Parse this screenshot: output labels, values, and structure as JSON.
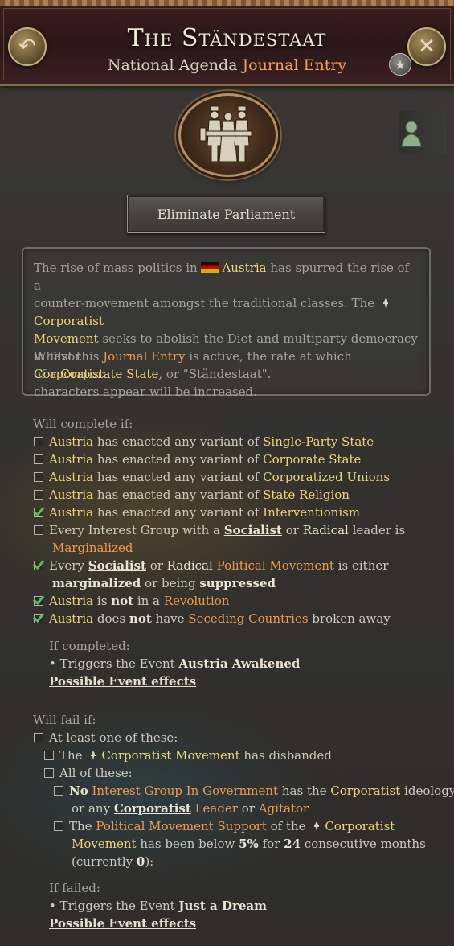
{
  "header": {
    "title": "The Ständestaat",
    "subtitle_a": "National Agenda",
    "subtitle_b": "Journal Entry"
  },
  "action_button": "Eliminate Parliament",
  "description": {
    "p1_a": "The rise of mass politics in",
    "country": "Austria",
    "p1_b": "has spurred the rise of a",
    "p1_c": "counter-movement amongst the traditional classes. The",
    "movement": "Corporatist",
    "movement_2": "Movement",
    "p1_d": "seeks to abolish the Diet and multiparty democracy in favor",
    "p1_e": "of a",
    "corporate_state": "Corporate State",
    "p1_f": ", or \"Ständestaat\".",
    "p2_a": "Whilst this",
    "journal_entry": "Journal Entry",
    "p2_b": "is active, the rate at which",
    "corporatist": "Corporatist",
    "p2_c": "characters appear will be increased."
  },
  "complete": {
    "label": "Will complete if:",
    "country": "Austria",
    "enacted": "has enacted any variant of",
    "laws": [
      "Single-Party State",
      "Corporate State",
      "Corporatized Unions",
      "State Religion",
      "Interventionism"
    ],
    "laws_done": [
      false,
      false,
      false,
      false,
      true
    ],
    "ig_a": "Every Interest Group with a",
    "socialist": "Socialist",
    "or": "or",
    "radical": "Radical",
    "ig_b": "leader is",
    "marginalized": "Marginalized",
    "every": "Every",
    "political_movement": "Political Movement",
    "is_either": "is either",
    "marginalized_lc": "marginalized",
    "or_being": "or being",
    "suppressed": "suppressed",
    "is": "is",
    "not": "not",
    "in_a": "in a",
    "revolution": "Revolution",
    "does": "does",
    "have": "have",
    "seceding": "Seceding Countries",
    "broken_away": "broken away",
    "if_completed": "If completed:",
    "triggers": "• Triggers the Event",
    "event_name": "Austria Awakened",
    "effects": "Possible Event effects"
  },
  "fail": {
    "label": "Will fail if:",
    "at_least_one": "At least one of these:",
    "the": "The",
    "corporatist": "Corporatist",
    "movement": "Movement",
    "disbanded": "has disbanded",
    "all_of": "All of these:",
    "no": "No",
    "ig_in_gov": "Interest Group In Government",
    "has_the": "has the",
    "ideology": "ideology,",
    "or_any": "or any",
    "leader": "Leader",
    "or": "or",
    "agitator": "Agitator",
    "the2": "The",
    "pm_support": "Political Movement Support",
    "of_the": "of the",
    "below": "has been below",
    "pct": "5%",
    "for": "for",
    "months_num": "24",
    "consecutive": "consecutive months",
    "currently_a": "(currently",
    "currently_val": "0",
    "currently_b": "):",
    "if_failed": "If failed:",
    "triggers": "• Triggers the Event",
    "event_name": "Just a Dream",
    "effects": "Possible Event effects"
  },
  "icons": {
    "back": "back-arrow-icon",
    "close": "close-icon",
    "favorite": "star-icon",
    "emblem": "corporatist-figures-emblem",
    "leader": "leader-bust-icon",
    "flag": "austria-flag-icon",
    "movement": "corporatist-movement-icon"
  },
  "colors": {
    "highlight_gold": "#efd37b",
    "highlight_orange": "#ee9a52",
    "check_green": "#5fb85a"
  }
}
